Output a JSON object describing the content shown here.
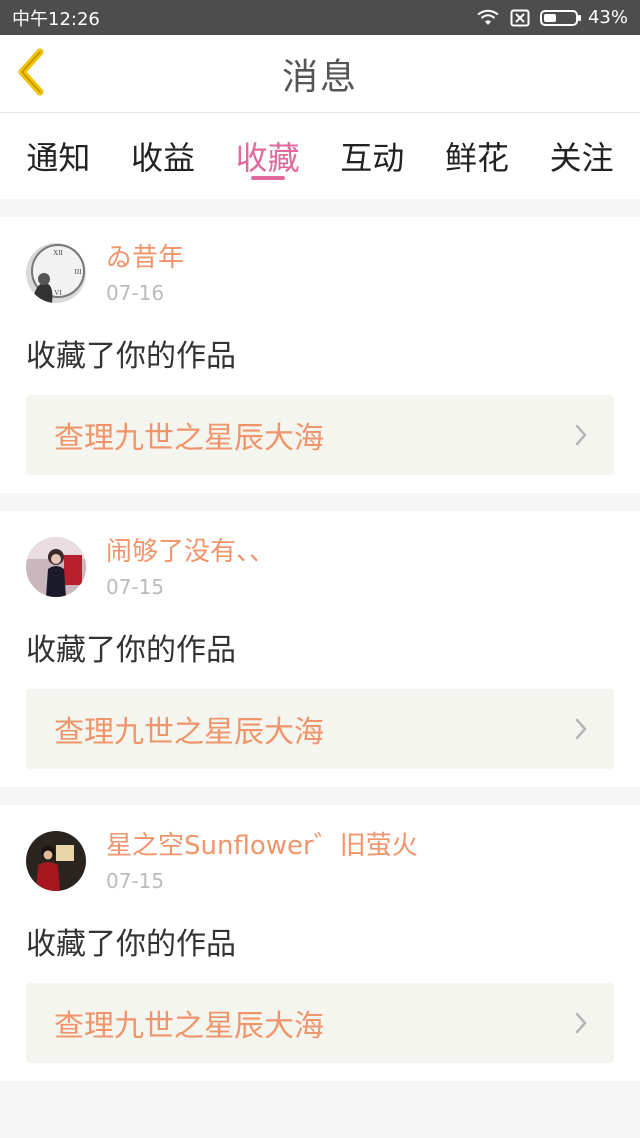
{
  "status_bar": {
    "carrier_time": "中午12:26",
    "battery": "43%",
    "icons": [
      "wifi-icon",
      "sim-icon",
      "battery-icon"
    ]
  },
  "header": {
    "title": "消息",
    "back_icon": "chevron-left-icon"
  },
  "tabs": [
    {
      "label": "通知",
      "active": false
    },
    {
      "label": "收益",
      "active": false
    },
    {
      "label": "收藏",
      "active": true
    },
    {
      "label": "互动",
      "active": false
    },
    {
      "label": "鲜花",
      "active": false
    },
    {
      "label": "关注",
      "active": false
    }
  ],
  "messages": [
    {
      "username": "ゐ昔年",
      "date": "07-16",
      "action": "收藏了你的作品",
      "work_title": "查理九世之星辰大海"
    },
    {
      "username": "闹够了没有、、",
      "date": "07-15",
      "action": "收藏了你的作品",
      "work_title": "查理九世之星辰大海"
    },
    {
      "username": "星之空Sunflower゛旧萤火",
      "date": "07-15",
      "action": "收藏了你的作品",
      "work_title": "查理九世之星辰大海"
    }
  ],
  "colors": {
    "accent": "#e06a9d",
    "username": "#f0956b",
    "back_icon": "#f2c100"
  }
}
